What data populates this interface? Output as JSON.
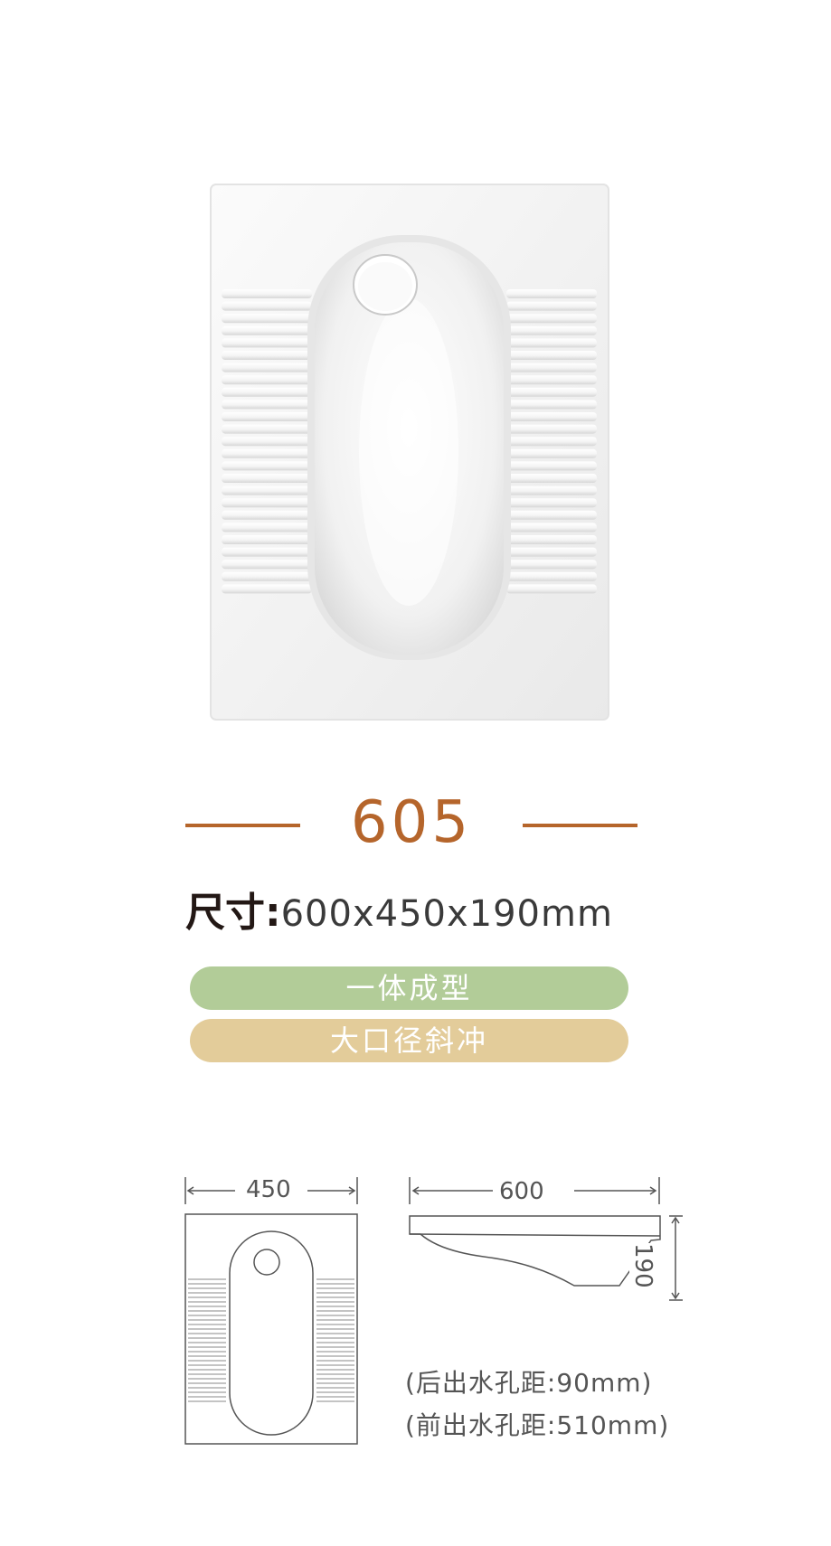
{
  "product": {
    "model": "605",
    "size_label": "尺寸:",
    "size_value": "600x450x190mm",
    "features": [
      "一体成型",
      "大口径斜冲"
    ],
    "dimensions": {
      "width": "450",
      "length": "600",
      "height": "190"
    },
    "notes": [
      "(后出水孔距:90mm)",
      "(前出水孔距:510mm)"
    ]
  },
  "colors": {
    "accent": "#b5652b",
    "pill_green": "#b2cc98",
    "pill_tan": "#e3cc9a",
    "drawing_stroke": "#555555"
  }
}
